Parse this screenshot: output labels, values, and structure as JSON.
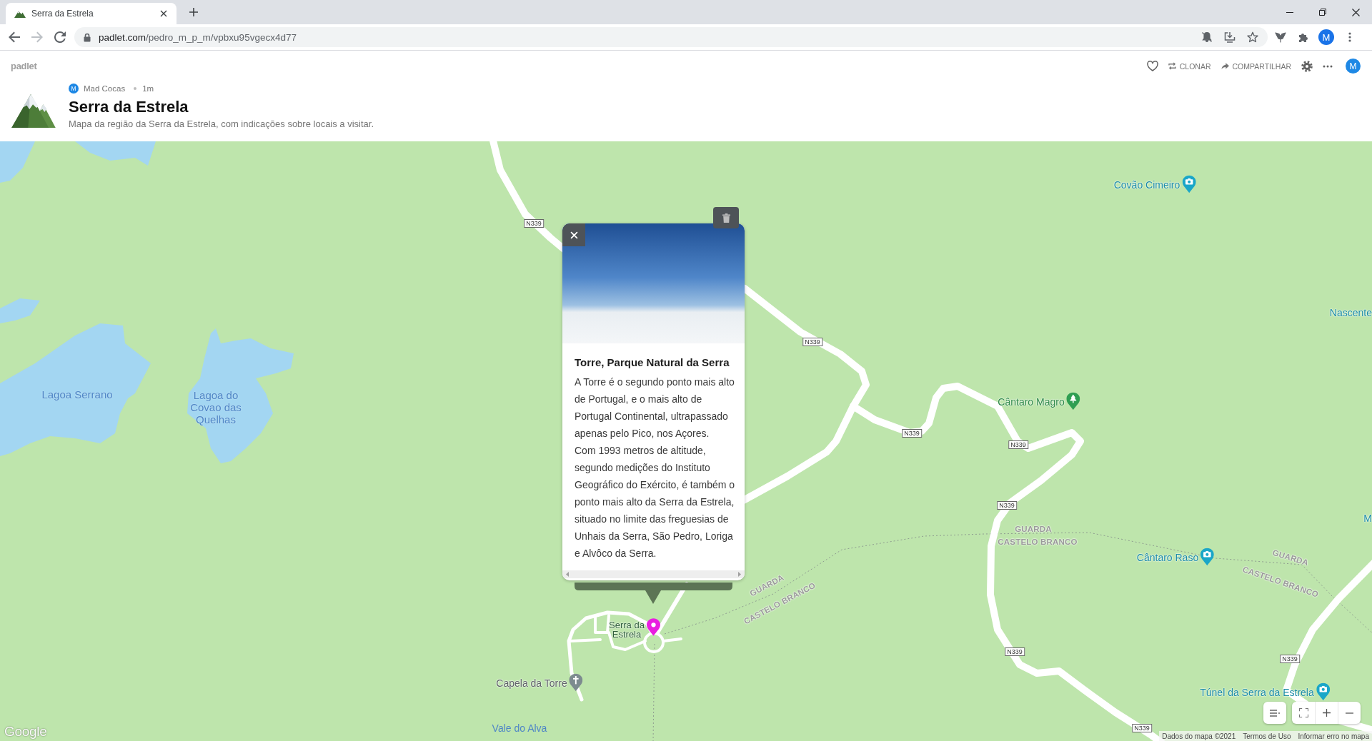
{
  "browser": {
    "tabs": [
      {
        "title": "Serra da Estrela",
        "selected": true
      }
    ],
    "nav": [
      {
        "kind": "back",
        "disabled": false
      },
      {
        "kind": "forward",
        "disabled": true
      },
      {
        "kind": "reload",
        "disabled": false
      }
    ],
    "url": {
      "host": "padlet.com",
      "path": "/pedro_m_p_m/vpbxu95vgecx4d77"
    },
    "profile_initial": "M"
  },
  "header": {
    "brand": "padlet",
    "author": {
      "initial": "M",
      "name": "Mad Cocas",
      "time": "1m"
    },
    "title": "Serra da Estrela",
    "description": "Mapa da região da Serra da Estrela, com indicações sobre locais a visitar.",
    "actions": [
      {
        "kind": "like"
      },
      {
        "kind": "clone",
        "label": "CLONAR"
      },
      {
        "kind": "share",
        "label": "COMPARTILHAR"
      },
      {
        "kind": "settings"
      },
      {
        "kind": "more"
      }
    ],
    "user_initial": "M"
  },
  "map": {
    "places": [
      {
        "name": "Covão Cimeiro",
        "kind": "viewpoint"
      },
      {
        "name": "Nascente",
        "kind": "attraction"
      },
      {
        "name": "Lagoa Serrano",
        "kind": "lake"
      },
      {
        "name": "Cântaro Magro",
        "kind": "park"
      },
      {
        "name": "Lagoa do Covao das Quelhas",
        "kind": "lake"
      },
      {
        "name": "M",
        "kind": "attraction"
      },
      {
        "name": "GUARDA",
        "kind": "boundary"
      },
      {
        "name": "CASTELO BRANCO",
        "kind": "boundary"
      },
      {
        "name": "Cântaro Raso",
        "kind": "viewpoint"
      },
      {
        "name": "GUARDA",
        "kind": "boundary"
      },
      {
        "name": "CASTELO BRANCO",
        "kind": "boundary"
      },
      {
        "name": "GUARDA",
        "kind": "boundary"
      },
      {
        "name": "CASTELO BRANCO",
        "kind": "boundary"
      },
      {
        "name": "Serra da Estrela",
        "kind": "town"
      },
      {
        "name": "Capela da Torre",
        "kind": "chapel"
      },
      {
        "name": "Túnel da Serra da Estrela",
        "kind": "viewpoint"
      },
      {
        "name": "Vale do Alva",
        "kind": "valley"
      }
    ],
    "road_numbers": [
      "N339",
      "N339",
      "N339",
      "N339",
      "N339",
      "N339",
      "N339",
      "N339"
    ],
    "post": {
      "title": "Torre, Parque Natural da Serra",
      "body": [
        "A Torre é o segundo ponto mais alto de Portugal, e o mais alto de Portugal Continental, ultrapassado apenas pelo Pico, nos Açores.",
        "Com 1993 metros de altitude, segundo medições do Instituto Geográfico do Exército, é também o ponto mais alto da Serra da Estrela, situado no limite das freguesias de Unhais da Serra, São Pedro, Loriga e Alvôco da Serra."
      ]
    },
    "attribution": {
      "logo": "Google",
      "data": "Dados do mapa ©2021",
      "terms": "Termos de Uso",
      "report": "Informar erro no mapa"
    }
  }
}
